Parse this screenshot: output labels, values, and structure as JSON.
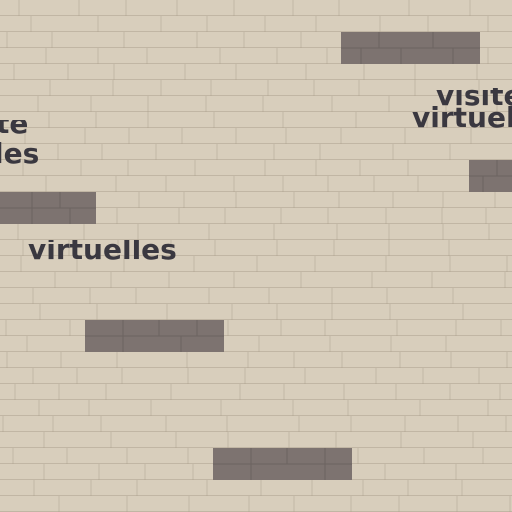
{
  "scene": {
    "background_color": "#d8cebc",
    "mortar_color": "#968a76",
    "platform_color": "#7d7370"
  },
  "labels": {
    "top_right_partial": "visite",
    "top_right": "virtuelle",
    "left_top_partial": "te",
    "left_second": "les",
    "middle": "virtuelles"
  }
}
